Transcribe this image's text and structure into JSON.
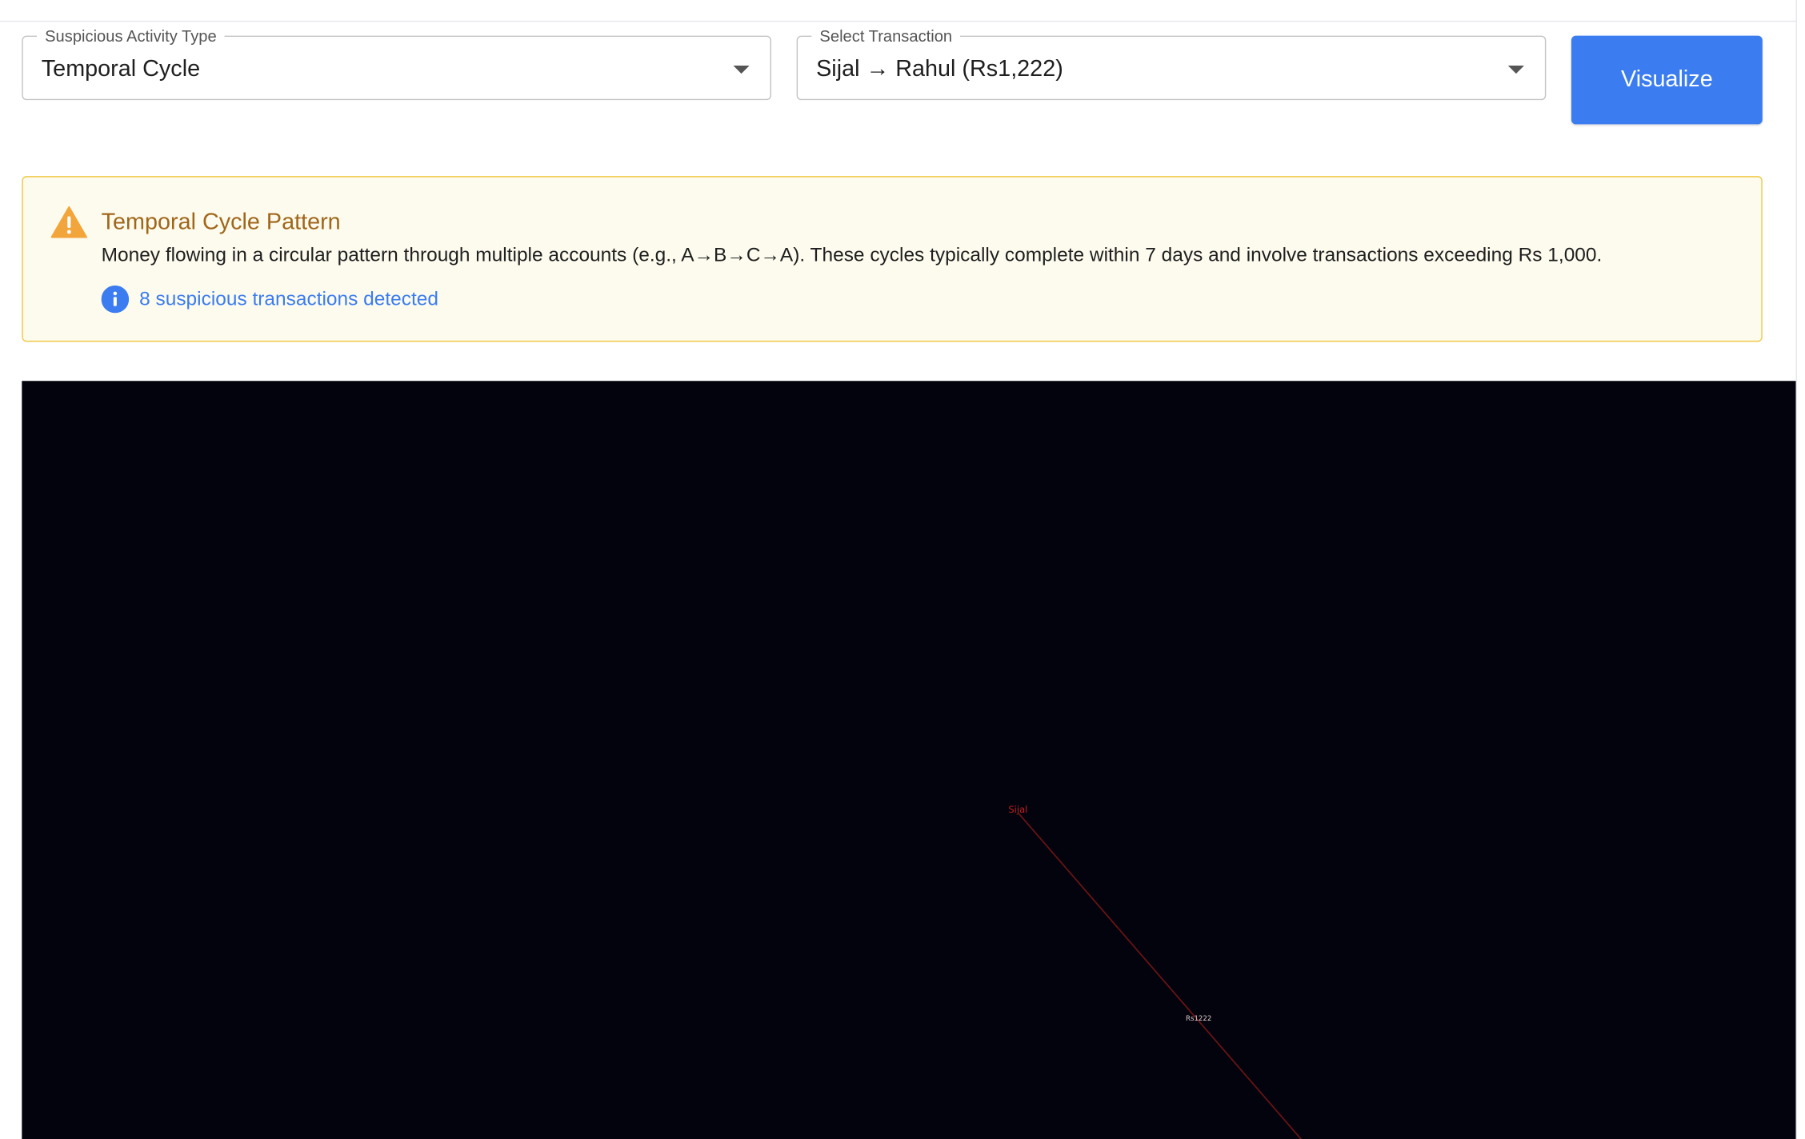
{
  "filters": {
    "activity_type": {
      "label": "Suspicious Activity Type",
      "value": "Temporal Cycle"
    },
    "transaction": {
      "label": "Select Transaction",
      "value": "Sijal → Rahul (Rs1,222)"
    },
    "visualize_label": "Visualize"
  },
  "alert": {
    "title": "Temporal Cycle Pattern",
    "description": "Money flowing in a circular pattern through multiple accounts (e.g., A→B→C→A). These cycles typically complete within 7 days and involve transactions exceeding Rs 1,000.",
    "info_text": "8 suspicious transactions detected",
    "warning_icon": "warning-triangle-icon",
    "info_icon": "info-circle-icon"
  },
  "graph": {
    "nodes": [
      "Sijal"
    ],
    "edge_label": "Rs1222"
  },
  "colors": {
    "accent": "#3b7cf0",
    "alert_bg": "#fdfbee",
    "alert_border": "#f0c948",
    "alert_title": "#a0661a",
    "canvas_bg": "#03030e",
    "edge": "#6a1414",
    "node_label": "#c21d1d"
  }
}
